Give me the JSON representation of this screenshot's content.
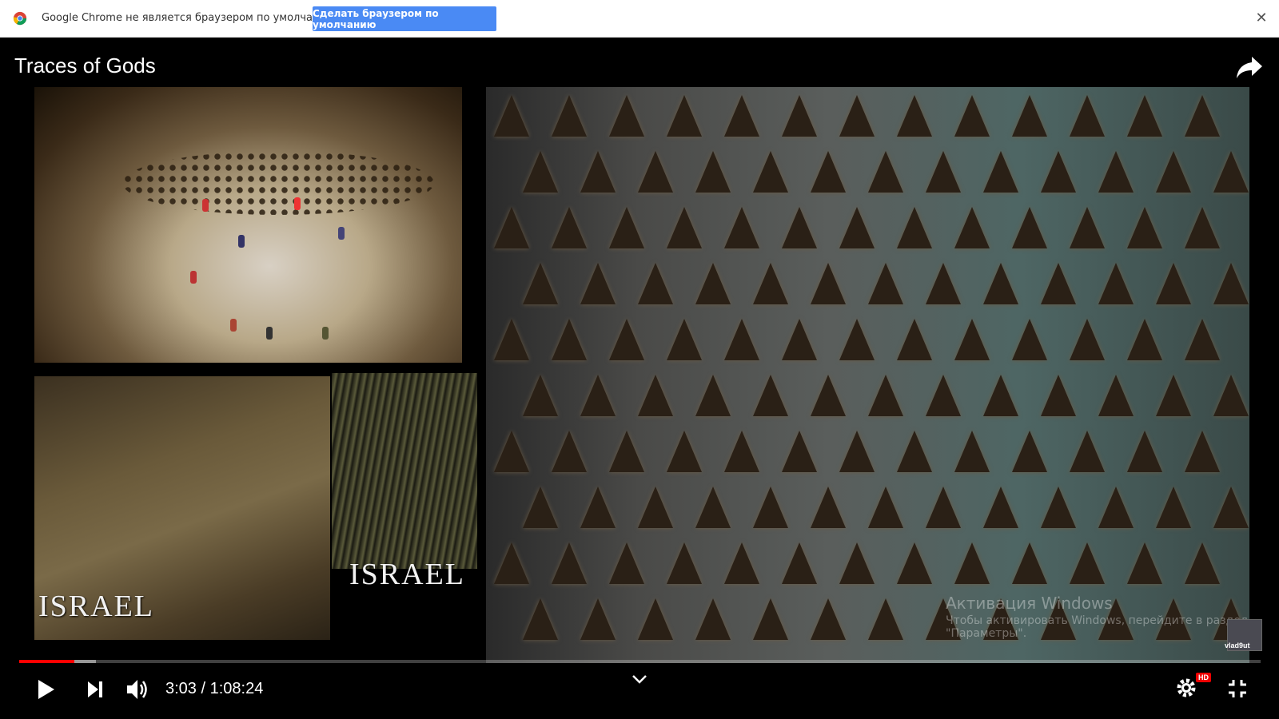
{
  "infobar": {
    "message": "Google Chrome не является браузером по умолчанию.",
    "default_button": "Сделать браузером по умолчанию",
    "close_icon": "close-icon"
  },
  "player": {
    "title": "Traces of Gods",
    "share_icon": "share-icon",
    "overlay_texts": [
      "ISRAEL",
      "ISRAEL"
    ],
    "watermark": {
      "line1": "Активация Windows",
      "line2": "Чтобы активировать Windows, перейдите в раздел \"Параметры\"."
    },
    "channel": "vlad9ut",
    "time": {
      "current": "3:03",
      "separator": "/",
      "duration": "1:08:24"
    },
    "progress_played_fraction": 0.0446,
    "buffered_fraction": 0.062,
    "hd_label": "HD",
    "colors": {
      "infobar_button": "#4a8af4",
      "progress_played": "#ff0000"
    }
  }
}
